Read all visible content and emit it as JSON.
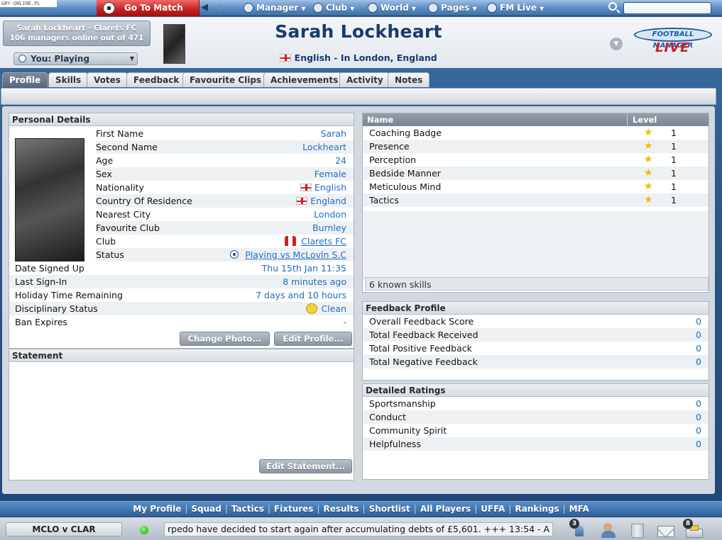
{
  "watermark": "GRY-ONLINE.PL",
  "topbar": {
    "go_to_match": "Go To Match",
    "menus": [
      "Manager",
      "Club",
      "World",
      "Pages",
      "FM Live"
    ]
  },
  "header": {
    "user_line1": "Sarah Lockheart - Clarets FC",
    "user_line2": "106 managers online out of 471",
    "status_select": "You: Playing",
    "manager_name": "Sarah Lockheart",
    "location": "English - In London, England",
    "logo_top": "FOOTBALL MANAGER",
    "logo_bottom": "LIVE"
  },
  "tabs": [
    "Profile",
    "Skills",
    "Votes",
    "Feedback",
    "Favourite Clips",
    "Achievements",
    "Activity",
    "Notes"
  ],
  "personal": {
    "title": "Personal Details",
    "rows": [
      {
        "label": "First Name",
        "value": "Sarah"
      },
      {
        "label": "Second Name",
        "value": "Lockheart"
      },
      {
        "label": "Age",
        "value": "24"
      },
      {
        "label": "Sex",
        "value": "Female"
      },
      {
        "label": "Nationality",
        "value": "English"
      },
      {
        "label": "Country Of Residence",
        "value": "England"
      },
      {
        "label": "Nearest City",
        "value": "London"
      },
      {
        "label": "Favourite Club",
        "value": "Burnley"
      },
      {
        "label": "Club",
        "value": "Clarets FC"
      },
      {
        "label": "Status",
        "value": "Playing vs McLovln S.C"
      },
      {
        "label": "Date Signed Up",
        "value": "Thu 15th Jan 11:35"
      },
      {
        "label": "Last Sign-In",
        "value": "8 minutes ago"
      },
      {
        "label": "Holiday Time Remaining",
        "value": "7 days and 10 hours"
      },
      {
        "label": "Disciplinary Status",
        "value": "Clean"
      },
      {
        "label": "Ban Expires",
        "value": "-"
      }
    ],
    "change_photo": "Change Photo...",
    "edit_profile": "Edit Profile..."
  },
  "statement": {
    "title": "Statement",
    "edit": "Edit Statement..."
  },
  "skills": {
    "col_name": "Name",
    "col_level": "Level",
    "rows": [
      {
        "name": "Coaching Badge",
        "level": "1"
      },
      {
        "name": "Presence",
        "level": "1"
      },
      {
        "name": "Perception",
        "level": "1"
      },
      {
        "name": "Bedside Manner",
        "level": "1"
      },
      {
        "name": "Meticulous Mind",
        "level": "1"
      },
      {
        "name": "Tactics",
        "level": "1"
      }
    ],
    "summary": "6 known skills"
  },
  "feedback": {
    "title": "Feedback Profile",
    "rows": [
      {
        "label": "Overall Feedback Score",
        "value": "0"
      },
      {
        "label": "Total Feedback Received",
        "value": "0"
      },
      {
        "label": "Total Positive Feedback",
        "value": "0"
      },
      {
        "label": "Total Negative Feedback",
        "value": "0"
      }
    ]
  },
  "ratings": {
    "title": "Detailed Ratings",
    "rows": [
      {
        "label": "Sportsmanship",
        "value": "0"
      },
      {
        "label": "Conduct",
        "value": "0"
      },
      {
        "label": "Community Spirit",
        "value": "0"
      },
      {
        "label": "Helpfulness",
        "value": "0"
      }
    ]
  },
  "bottomnav": [
    "My Profile",
    "Squad",
    "Tactics",
    "Fixtures",
    "Results",
    "Shortlist",
    "All Players",
    "UFFA",
    "Rankings",
    "MFA"
  ],
  "statusbar": {
    "match": "MCLO v CLAR",
    "ticker": "rpedo have decided to start again after accumulating debts of £5,601.   +++   13:54 - A",
    "badge_left": "3",
    "badge_right": "8"
  }
}
